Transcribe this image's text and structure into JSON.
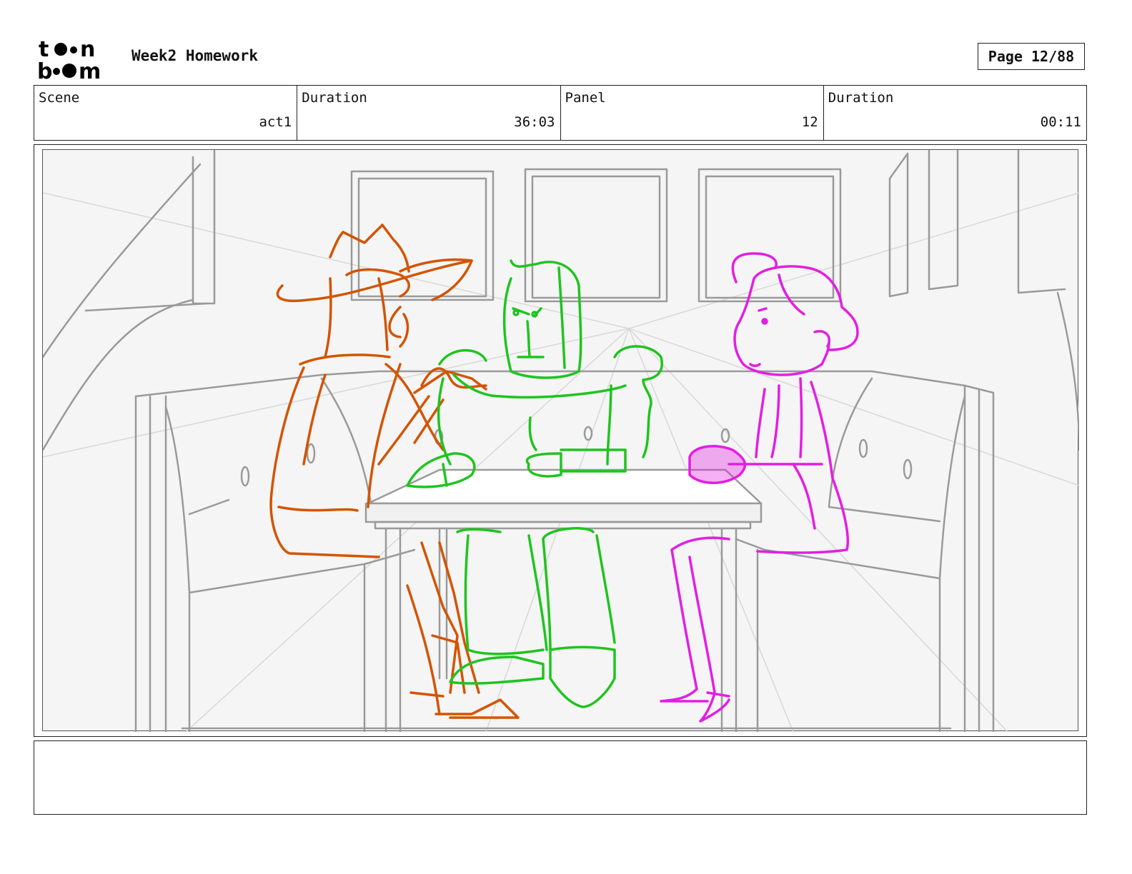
{
  "header": {
    "logo_text": "toon boom",
    "document_title": "Week2 Homework",
    "page_indicator": "Page 12/88"
  },
  "info_fields": [
    {
      "label": "Scene",
      "value": "act1"
    },
    {
      "label": "Duration",
      "value": "36:03"
    },
    {
      "label": "Panel",
      "value": "12"
    },
    {
      "label": "Duration",
      "value": "00:11"
    }
  ],
  "panel": {
    "background_sketch_color": "#9a9a9a",
    "characters": [
      {
        "name": "cowboy",
        "color": "#d35400"
      },
      {
        "name": "robot",
        "color": "#1fc41f"
      },
      {
        "name": "girl",
        "color": "#e31ee3"
      }
    ]
  },
  "notes": {
    "text": ""
  }
}
